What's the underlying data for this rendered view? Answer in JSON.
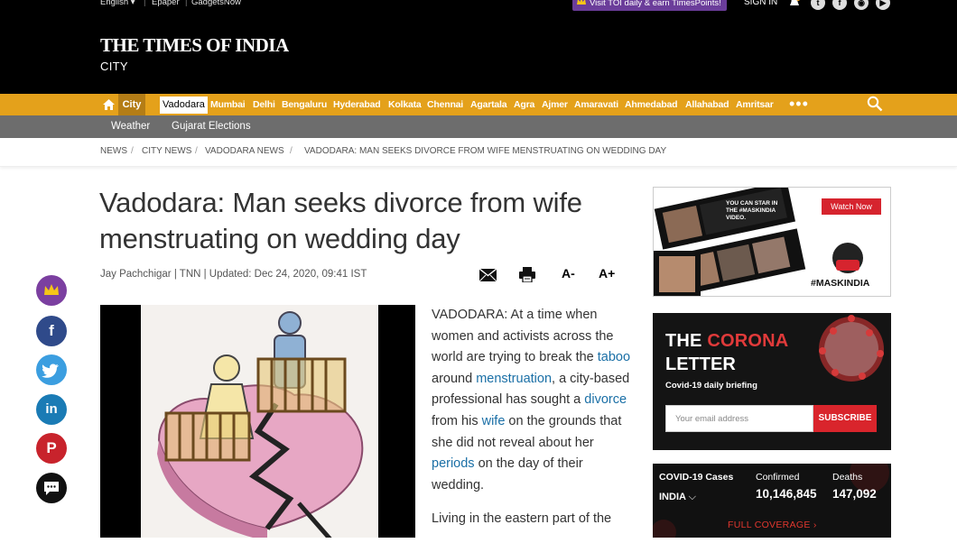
{
  "topbar": {
    "language": "English ▾",
    "epaper": "Epaper",
    "gadgetsnow": "GadgetsNow",
    "promo": "Visit TOI daily & earn TimesPoints!",
    "signin": "SIGN IN",
    "promo_color": "#6b3d9a"
  },
  "header": {
    "logo": "THE TIMES OF INDIA",
    "section": "CITY"
  },
  "nav": {
    "city": "City",
    "active": "Vadodara",
    "items": [
      "Mumbai",
      "Delhi",
      "Bengaluru",
      "Hyderabad",
      "Kolkata",
      "Chennai",
      "Agartala",
      "Agra",
      "Ajmer",
      "Amaravati",
      "Ahmedabad",
      "Allahabad",
      "Amritsar"
    ],
    "more": "•••",
    "bar_color": "#e4a11b"
  },
  "subnav": {
    "items": [
      "Weather",
      "Gujarat Elections"
    ]
  },
  "breadcrumb": {
    "items": [
      "NEWS",
      "CITY NEWS",
      "VADODARA NEWS",
      "VADODARA: MAN SEEKS DIVORCE FROM WIFE MENSTRUATING ON WEDDING DAY"
    ]
  },
  "article": {
    "headline": "Vadodara: Man seeks divorce from wife menstruating on wedding day",
    "byline": "Jay Pachchigar | TNN | Updated: Dec 24, 2020, 09:41 IST",
    "font_smaller": "A-",
    "font_larger": "A+",
    "body": {
      "p1_a": "VADODARA: At a time when women and activists across the world are trying to break the ",
      "kw_taboo": "taboo",
      "p1_b": " around ",
      "kw_menstruation": "menstruation",
      "p1_c": ", a city-based professional has sought a ",
      "kw_divorce": "divorce",
      "p1_d": " from his ",
      "kw_wife": "wife",
      "p1_e": " on the grounds that she did not reveal about her ",
      "kw_periods": "periods",
      "p1_f": " on the day of their wedding.",
      "p2": "Living in the eastern part of the"
    }
  },
  "share": {
    "icons": [
      "crown-icon",
      "facebook-icon",
      "twitter-icon",
      "linkedin-icon",
      "pinterest-icon",
      "comment-icon"
    ]
  },
  "ads": {
    "maskindia_caption": "YOU CAN STAR IN THE #MASKINDIA VIDEO.",
    "watch_now": "Watch Now",
    "hashtag": "#MASKINDIA"
  },
  "corona_letter": {
    "title_a": "THE ",
    "title_red": "CORONA",
    "title_b": "LETTER",
    "subtitle": "Covid-19 daily briefing",
    "email_placeholder": "Your email address",
    "subscribe": "SUBSCRIBE"
  },
  "covid_stats": {
    "heading": "COVID-19 Cases",
    "region": "INDIA",
    "confirmed_label": "Confirmed",
    "confirmed_value": "10,146,845",
    "deaths_label": "Deaths",
    "deaths_value": "147,092",
    "full_coverage": "FULL COVERAGE ›"
  }
}
